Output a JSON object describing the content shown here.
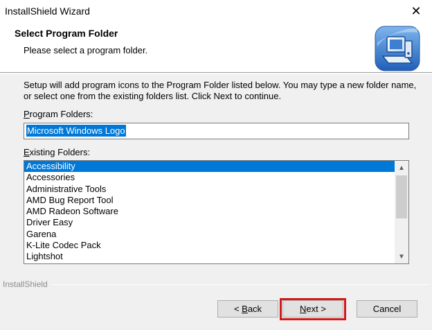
{
  "window": {
    "title": "InstallShield Wizard",
    "close_glyph": "✕"
  },
  "header": {
    "title": "Select Program Folder",
    "subtitle": "Please select a program folder.",
    "logo_icon": "computer-setup-icon"
  },
  "body": {
    "description": "Setup will add program icons to the Program Folder listed below.  You may type a new folder name, or select one from the existing folders list.  Click Next to continue.",
    "program_folders_label_u": "P",
    "program_folders_label_rest": "rogram Folders:",
    "program_folder_value": "Microsoft Windows Logo",
    "existing_folders_label_u": "E",
    "existing_folders_label_rest": "xisting Folders:",
    "existing_folders": [
      "Accessibility",
      "Accessories",
      "Administrative Tools",
      "AMD Bug Report Tool",
      "AMD Radeon Software",
      "Driver Easy",
      "Garena",
      "K-Lite Codec Pack",
      "Lightshot"
    ],
    "selected_index": 0,
    "scroll_up_glyph": "▲",
    "scroll_down_glyph": "▼"
  },
  "footer": {
    "brand": "InstallShield",
    "back_prefix": "< ",
    "back_u": "B",
    "back_rest": "ack",
    "next_u": "N",
    "next_rest": "ext >",
    "cancel_label": "Cancel",
    "highlight_color": "#d11a1a"
  }
}
